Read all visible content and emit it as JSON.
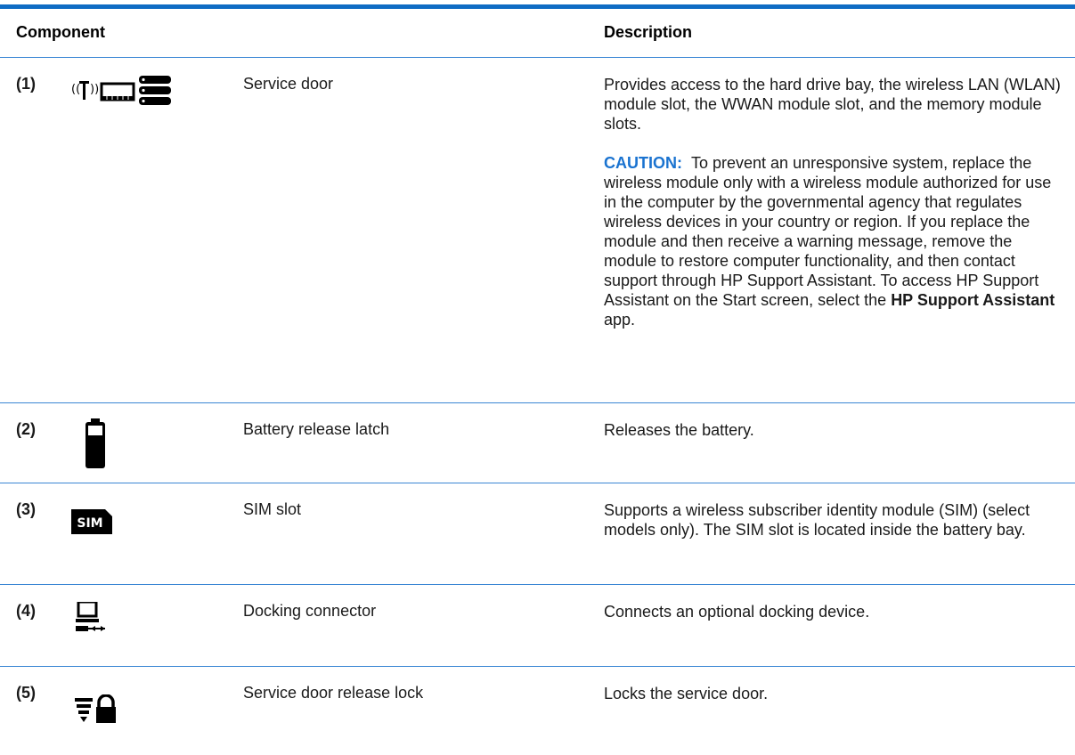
{
  "table": {
    "headers": {
      "component": "Component",
      "description": "Description"
    },
    "rows": [
      {
        "num": "(1)",
        "icon": "wireless-memory-harddrive-icon",
        "component": "Service door",
        "desc": "Provides access to the hard drive bay, the wireless LAN (WLAN) module slot, the WWAN module slot, and the memory module slots.",
        "caution_label": "CAUTION:",
        "caution_text": "To prevent an unresponsive system, replace the wireless module only with a wireless module authorized for use in the computer by the governmental agency that regulates wireless devices in your country or region. If you replace the module and then receive a warning message, remove the module to restore computer functionality, and then contact support through HP Support Assistant. To access HP Support Assistant on the Start screen, select the",
        "caution_bold": "HP Support Assistant",
        "caution_tail": "app."
      },
      {
        "num": "(2)",
        "icon": "battery-icon",
        "component": "Battery release latch",
        "desc": "Releases the battery."
      },
      {
        "num": "(3)",
        "icon": "sim-card-icon",
        "icon_text": "SIM",
        "component": "SIM slot",
        "desc": "Supports a wireless subscriber identity module (SIM) (select models only). The SIM slot is located inside the battery bay."
      },
      {
        "num": "(4)",
        "icon": "docking-connector-icon",
        "component": "Docking connector",
        "desc": "Connects an optional docking device."
      },
      {
        "num": "(5)",
        "icon": "service-door-lock-icon",
        "component": "Service door release lock",
        "desc": "Locks the service door."
      }
    ]
  },
  "colors": {
    "accent": "#0f6cc4",
    "separator": "#3a86d4",
    "caution": "#1a73d0"
  }
}
